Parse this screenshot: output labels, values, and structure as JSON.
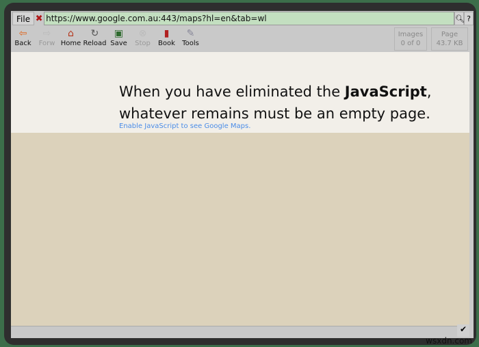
{
  "urlbar": {
    "file_label": "File",
    "url": "https://www.google.com.au:443/maps?hl=en&tab=wl",
    "search_icon": "magnifier-icon",
    "help_label": "?"
  },
  "toolbar": [
    {
      "label": "Back",
      "icon": "⇦",
      "disabled": false
    },
    {
      "label": "Forw",
      "icon": "⇨",
      "disabled": true
    },
    {
      "label": "Home",
      "icon": "⌂",
      "disabled": false
    },
    {
      "label": "Reload",
      "icon": "↻",
      "disabled": false
    },
    {
      "label": "Save",
      "icon": "▣",
      "disabled": false
    },
    {
      "label": "Stop",
      "icon": "⊗",
      "disabled": true
    },
    {
      "label": "Book",
      "icon": "▮",
      "disabled": false
    },
    {
      "label": "Tools",
      "icon": "✎",
      "disabled": false
    }
  ],
  "info": {
    "images_label": "Images",
    "images_value": "0 of 0",
    "page_label": "Page",
    "page_value": "43.7 KB"
  },
  "page": {
    "line1_pre": "When you have eliminated the ",
    "line1_bold": "JavaScript",
    "line1_post": ",",
    "line2": "whatever remains must be an empty page.",
    "link": "Enable JavaScript to see Google Maps."
  },
  "status": {
    "check_icon": "✔"
  },
  "watermark": "wsxdn.com"
}
